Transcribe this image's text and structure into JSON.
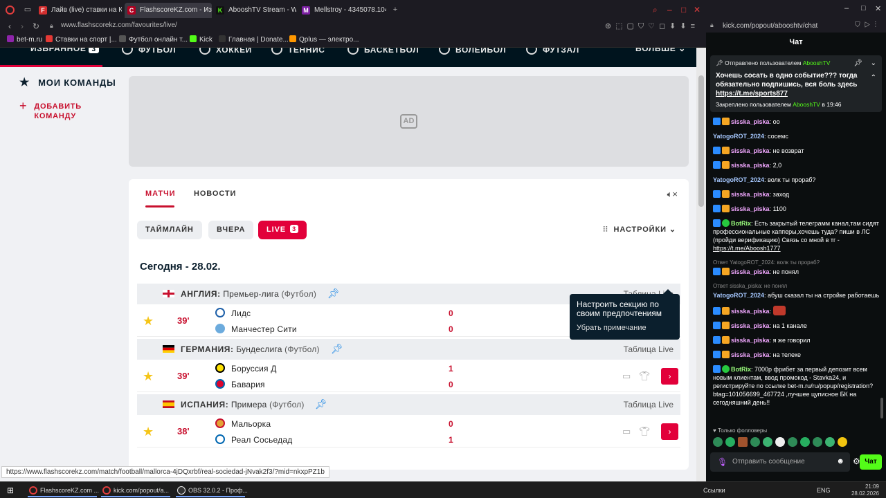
{
  "browser_left": {
    "tabs": [
      {
        "label": "Лайв (live) ставки на Киб",
        "icon": "f-red"
      },
      {
        "label": "FlashscoreKZ.com - Избр",
        "icon": "flashscore",
        "active": true
      },
      {
        "label": "AbooshTV Stream - Watc",
        "icon": "kick"
      },
      {
        "label": "Mellstroy - 4345078.1047",
        "icon": "purple"
      }
    ],
    "url": "www.flashscorekz.com/favourites/live/",
    "bookmarks": [
      "bet-m.ru",
      "Ставки на спорт |...",
      "Футбол онлайн т...",
      "Kick",
      "Главная | Donate...",
      "Qplus — электро..."
    ],
    "status_url": "https://www.flashscorekz.com/match/football/mallorca-4jDQxrbf/real-sociedad-jNvak2f3/?mid=nkxpPZ1b"
  },
  "flashscore": {
    "sport_nav": [
      {
        "label": "ИЗБРАННОЕ",
        "count": "3"
      },
      {
        "label": "ФУТБОЛ"
      },
      {
        "label": "ХОККЕЙ"
      },
      {
        "label": "ТЕННИС"
      },
      {
        "label": "БАСКЕТБОЛ"
      },
      {
        "label": "ВОЛЕЙБОЛ"
      },
      {
        "label": "ФУТЗАЛ"
      },
      {
        "label": "БОЛЬШЕ"
      }
    ],
    "sidebar": {
      "my_teams": "МОИ КОМАНДЫ",
      "add_team": "ДОБАВИТЬ КОМАНДУ"
    },
    "ad_label": "AD",
    "tabs": {
      "matches": "МАТЧИ",
      "news": "НОВОСТИ"
    },
    "filters": {
      "timeline": "ТАЙМЛАЙН",
      "yesterday": "ВЧЕРА",
      "live": "LIVE",
      "live_count": "3"
    },
    "settings": "НАСТРОЙКИ",
    "today": "Сегодня - 28.02.",
    "tooltip": {
      "text": "Настроить секцию по своим предпочтениям",
      "dismiss": "Убрать примечание"
    },
    "leagues": [
      {
        "country": "АНГЛИЯ:",
        "name": "Премьер-лига",
        "sport": "(Футбол)",
        "table_link": "Таблица Live",
        "match": {
          "minute": "39'",
          "home": "Лидс",
          "away": "Манчестер Сити",
          "home_score": "0",
          "away_score": "0"
        }
      },
      {
        "country": "ГЕРМАНИЯ:",
        "name": "Бундеслига",
        "sport": "(Футбол)",
        "table_link": "Таблица Live",
        "match": {
          "minute": "39'",
          "home": "Боруссия Д",
          "away": "Бавария",
          "home_score": "1",
          "away_score": "0"
        }
      },
      {
        "country": "ИСПАНИЯ:",
        "name": "Примера",
        "sport": "(Футбол)",
        "table_link": "Таблица Live",
        "match": {
          "minute": "38'",
          "home": "Мальорка",
          "away": "Реал Сосьедад",
          "home_score": "0",
          "away_score": "1"
        }
      }
    ]
  },
  "browser_right": {
    "url": "kick.com/popout/abooshtv/chat",
    "chat_title": "Чат",
    "pinned": {
      "header_prefix": "Отправлено пользователем",
      "sender": "AbooshTV",
      "body": "Хочешь сосать в одно событие??? тогда обязательно подпишись, вся боль здесь",
      "link": "https://t.me/sports877",
      "footer_prefix": "Закреплено пользователем",
      "footer_user": "AbooshTV",
      "footer_time": "в 19:46"
    },
    "messages": [
      {
        "user": "sisska_piska",
        "color": "pink",
        "badges": [
          "blue",
          "crown"
        ],
        "text": "оо"
      },
      {
        "user": "YatogoROT_2024",
        "color": "blue",
        "badges": [],
        "text": "сосемс"
      },
      {
        "user": "sisska_piska",
        "color": "pink",
        "badges": [
          "blue",
          "crown"
        ],
        "text": "не возврат"
      },
      {
        "user": "sisska_piska",
        "color": "pink",
        "badges": [
          "blue",
          "crown"
        ],
        "text": "2,0"
      },
      {
        "user": "YatogoROT_2024",
        "color": "blue",
        "badges": [],
        "text": "волк ты прораб?"
      },
      {
        "user": "sisska_piska",
        "color": "pink",
        "badges": [
          "blue",
          "crown"
        ],
        "text": "заход"
      },
      {
        "user": "sisska_piska",
        "color": "pink",
        "badges": [
          "blue",
          "crown"
        ],
        "text": "1100"
      },
      {
        "user": "BotRix",
        "color": "green",
        "badges": [
          "blue",
          "ok"
        ],
        "text": "Есть закрытый телеграмм канал,там сидят профессиональные капперы,хочешь туда? пиши в ЛС (пройди верификацию) Связь со мной в тг -",
        "link": "https://t.me/Aboosh1777"
      },
      {
        "reply": "Ответ YatogoROT_2024: волк ты прораб?",
        "user": "sisska_piska",
        "color": "pink",
        "badges": [
          "blue",
          "crown"
        ],
        "text": "не понял"
      },
      {
        "reply": "Ответ sisska_piska: не понял",
        "user": "YatogoROT_2024",
        "color": "blue",
        "badges": [],
        "text": "абуш сказал ты на стройке работаешь"
      },
      {
        "user": "sisska_piska",
        "color": "pink",
        "badges": [
          "blue",
          "crown"
        ],
        "text": "",
        "emote": true
      },
      {
        "user": "sisska_piska",
        "color": "pink",
        "badges": [
          "blue",
          "crown"
        ],
        "text": "на 1 канале"
      },
      {
        "user": "sisska_piska",
        "color": "pink",
        "badges": [
          "blue",
          "crown"
        ],
        "text": "я же говорил"
      },
      {
        "user": "sisska_piska",
        "color": "pink",
        "badges": [
          "blue",
          "crown"
        ],
        "text": "на телеке"
      },
      {
        "user": "BotRix",
        "color": "green",
        "badges": [
          "blue",
          "ok"
        ],
        "text": "7000р фрибет за первый депозит всем новым клиентам, ввод промокод - Stavka24, и регистрируйте по ссылке bet-m.ru/ru/popup/registration?btag=101056699_467724 ,лучшее цуписное БК на сегодняшний день!!"
      }
    ],
    "followers_only": "Только фолловеры",
    "input_placeholder": "Отправить сообщение",
    "chat_button": "Чат"
  },
  "taskbar": {
    "apps": [
      "FlashscoreKZ.com ...",
      "kick.com/popout/a...",
      "OBS 32.0.2 - Проф..."
    ],
    "links_label": "Ссылки",
    "lang": "ENG",
    "time": "21:09",
    "date": "28.02.2026"
  }
}
